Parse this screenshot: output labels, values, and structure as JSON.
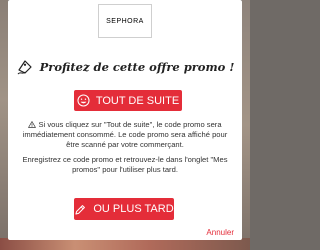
{
  "logo": {
    "text": "SEPHORA"
  },
  "title": "Profitez de cette offre promo !",
  "primary_button": {
    "label": "TOUT DE SUITE"
  },
  "primary_message": "Si vous cliquez sur \"Tout de suite\", le code promo sera immédiatement consommé. Le code promo sera affiché pour être scanné par votre commerçant.",
  "secondary_button": {
    "label": "OU PLUS TARD"
  },
  "secondary_message": "Enregistrez ce code promo et retrouvez-le dans l'onglet \"Mes promos\" pour l'utiliser plus tard.",
  "cancel_label": "Annuler",
  "icons": {
    "title": "pencil-tag-icon",
    "primary": "smiley-icon",
    "secondary": "pencil-icon",
    "warning": "warning-icon"
  },
  "colors": {
    "accent": "#e42d39",
    "text": "#333333"
  }
}
